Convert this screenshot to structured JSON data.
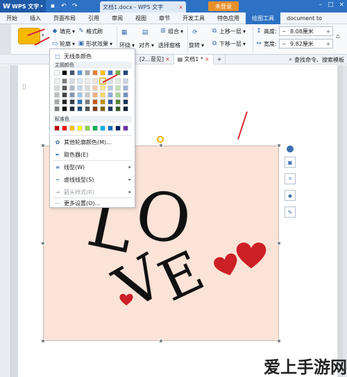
{
  "titlebar": {
    "app_name": "WPS 文字",
    "doc_title": "文档1.docx - WPS 文字",
    "login": "未登录"
  },
  "menu": [
    "开始",
    "插入",
    "页面布局",
    "引用",
    "审阅",
    "视图",
    "章节",
    "开发工具",
    "特色应用",
    "绘图工具",
    "document to"
  ],
  "ribbon": {
    "fill": "填充",
    "format_painter": "格式刷",
    "outline": "轮廓",
    "shape_effects": "形状效果",
    "wrap": "环绕",
    "align": "对齐",
    "combine": "组合",
    "select_pane": "选择窗格",
    "rotate": "旋转",
    "bring_forward": "上移一层",
    "send_backward": "下移一层",
    "height_label": "高度:",
    "height_value": "8.08厘米",
    "width_label": "宽度:",
    "width_value": "9.82厘米"
  },
  "tabs2": {
    "t1": "[2...意见]",
    "t2": "文档1 *",
    "search": "查找命令、搜索模板"
  },
  "dropdown": {
    "no_outline": "无线条颜色",
    "theme_colors": "主题颜色",
    "standard_colors": "标准色",
    "more_colors": "其他轮廓颜色(M)...",
    "eyedropper": "取色器(E)",
    "line_style": "线型(W)",
    "dash_style": "虚线线型(S)",
    "arrow_style": "箭头样式(R)",
    "more_settings": "更多设置(O)..."
  },
  "art_text": {
    "l": "L",
    "o": "O",
    "v": "V",
    "e": "E"
  },
  "watermark": "爱上手游网",
  "colors": {
    "title_blue": "#2d72c4",
    "login_orange": "#e8902a",
    "shape_yellow": "#f6b800",
    "image_bg": "#fbe3d7",
    "heart_red": "#cc1f26",
    "arrow_red": "#d92a2a"
  }
}
